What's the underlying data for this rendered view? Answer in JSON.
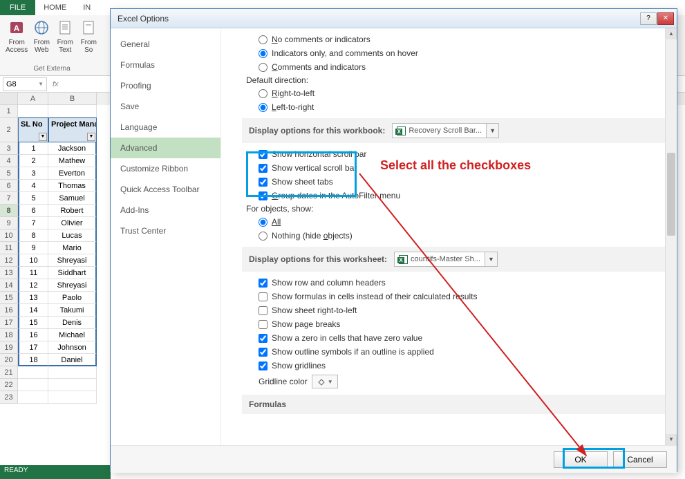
{
  "ribbon": {
    "tabs": {
      "file": "FILE",
      "home": "HOME",
      "insert_partial": "IN"
    },
    "buttons": {
      "from_access": "From\nAccess",
      "from_web": "From\nWeb",
      "from_text": "From\nText",
      "from_sources": "From\nSo"
    },
    "group_name": "Get Externa"
  },
  "formula": {
    "name_box": "G8",
    "fx": "fx"
  },
  "sheet": {
    "cols": [
      "A",
      "B"
    ],
    "header": {
      "a": "SL No",
      "b": "Project Manager"
    },
    "rows": [
      {
        "n": 1,
        "a": "1",
        "b": "Jackson"
      },
      {
        "n": 2,
        "a": "2",
        "b": "Mathew"
      },
      {
        "n": 3,
        "a": "3",
        "b": "Everton"
      },
      {
        "n": 4,
        "a": "4",
        "b": "Thomas"
      },
      {
        "n": 5,
        "a": "5",
        "b": "Samuel"
      },
      {
        "n": 6,
        "a": "6",
        "b": "Robert"
      },
      {
        "n": 7,
        "a": "7",
        "b": "Olivier"
      },
      {
        "n": 8,
        "a": "8",
        "b": "Lucas"
      },
      {
        "n": 9,
        "a": "9",
        "b": "Mario"
      },
      {
        "n": 10,
        "a": "10",
        "b": "Shreyasi"
      },
      {
        "n": 11,
        "a": "11",
        "b": "Siddhart"
      },
      {
        "n": 12,
        "a": "12",
        "b": "Shreyasi"
      },
      {
        "n": 13,
        "a": "13",
        "b": "Paolo"
      },
      {
        "n": 14,
        "a": "14",
        "b": "Takumi"
      },
      {
        "n": 15,
        "a": "15",
        "b": "Denis"
      },
      {
        "n": 16,
        "a": "16",
        "b": "Michael"
      },
      {
        "n": 17,
        "a": "17",
        "b": "Johnson"
      },
      {
        "n": 18,
        "a": "18",
        "b": "Daniel"
      }
    ],
    "empty_end_rows": [
      "21",
      "22",
      "23"
    ]
  },
  "status": "READY",
  "dialog": {
    "title": "Excel Options",
    "sidebar": [
      "General",
      "Formulas",
      "Proofing",
      "Save",
      "Language",
      "Advanced",
      "Customize Ribbon",
      "Quick Access Toolbar",
      "Add-Ins",
      "Trust Center"
    ],
    "active_sidebar": "Advanced",
    "comments": {
      "opt1": "No comments or indicators",
      "opt2": "Indicators only, and comments on hover",
      "opt3": "Comments and indicators"
    },
    "direction": {
      "heading": "Default direction:",
      "rtl": "Right-to-left",
      "ltr": "Left-to-right"
    },
    "workbook_section": {
      "title": "Display options for this workbook:",
      "combo": "Recovery Scroll Bar...",
      "hscroll": "Show horizontal scroll bar",
      "vscroll": "Show vertical scroll bar",
      "tabs": "Show sheet tabs",
      "group_dates": "Group dates in the AutoFilter menu",
      "for_objects": "For objects, show:",
      "all": "All",
      "nothing": "Nothing (hide objects)"
    },
    "worksheet_section": {
      "title": "Display options for this worksheet:",
      "combo": "countifs-Master Sh...",
      "headers": "Show row and column headers",
      "formulas": "Show formulas in cells instead of their calculated results",
      "rtl": "Show sheet right-to-left",
      "page_breaks": "Show page breaks",
      "zero": "Show a zero in cells that have zero value",
      "outline": "Show outline symbols if an outline is applied",
      "gridlines": "Show gridlines",
      "gridline_color": "Gridline color"
    },
    "formulas_section": "Formulas",
    "buttons": {
      "ok": "OK",
      "cancel": "Cancel"
    }
  },
  "annotation": "Select all the checkboxes"
}
